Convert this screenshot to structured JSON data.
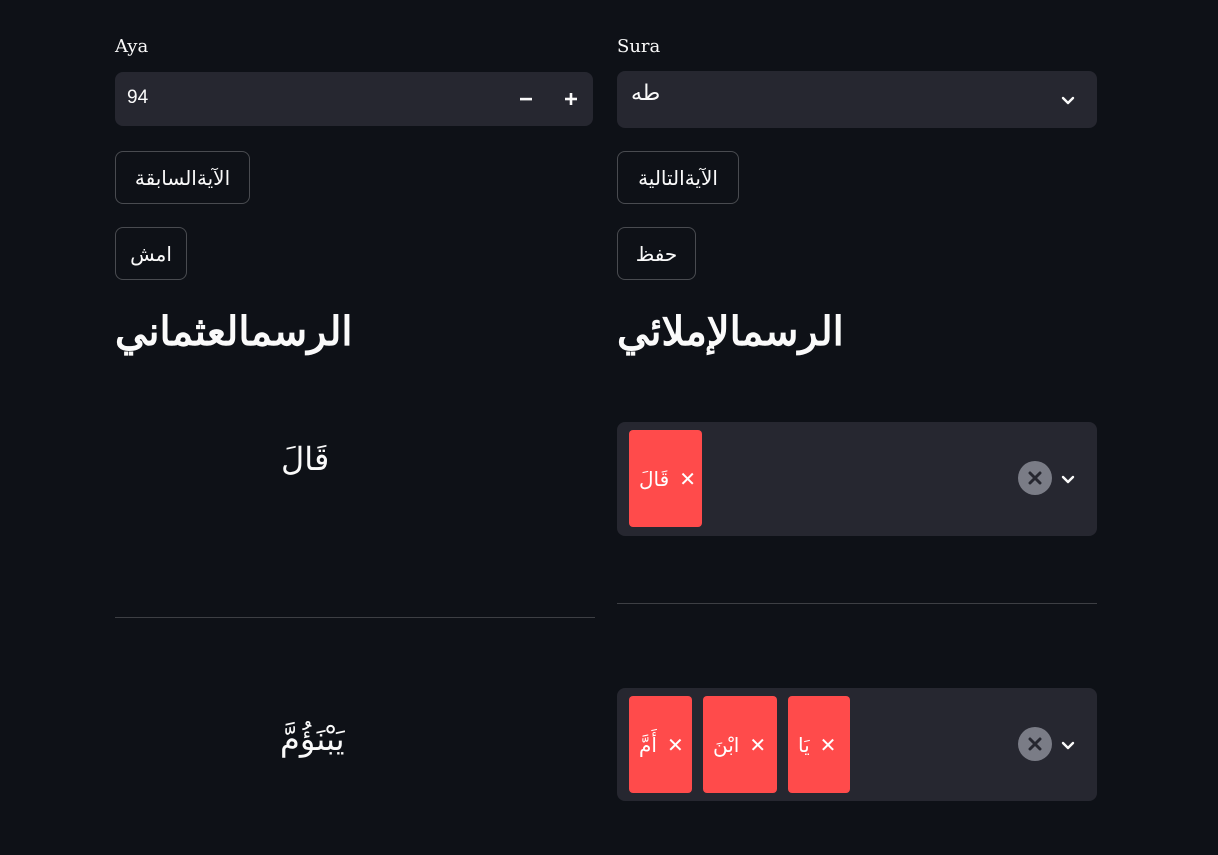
{
  "aya": {
    "label": "Aya",
    "value": "94",
    "decrement_symbol": "−",
    "increment_symbol": "+"
  },
  "sura": {
    "label": "Sura",
    "selected": "طه"
  },
  "buttons": {
    "previous_aya": "الآيةالسابقة",
    "next_aya": "الآيةالتالية",
    "erase": "امش",
    "save": "حفظ"
  },
  "headings": {
    "uthmani": "الرسمالعثماني",
    "imlaei": "الرسمالإملائي"
  },
  "rows": [
    {
      "uthmani_word": "قَالَ",
      "tags": [
        "قَالَ"
      ]
    },
    {
      "uthmani_word": "يَبْنَؤُمَّ",
      "tags": [
        "يَا",
        "ابْنَ",
        "أَمَّ"
      ]
    }
  ],
  "colors": {
    "background": "#0e1117",
    "input_bg": "#262730",
    "tag_bg": "#ff4b4b",
    "text": "#fafafa"
  },
  "icons": {
    "tag_remove": "close-icon",
    "clear_all": "clear-circle-icon",
    "dropdown": "chevron-down-icon"
  }
}
